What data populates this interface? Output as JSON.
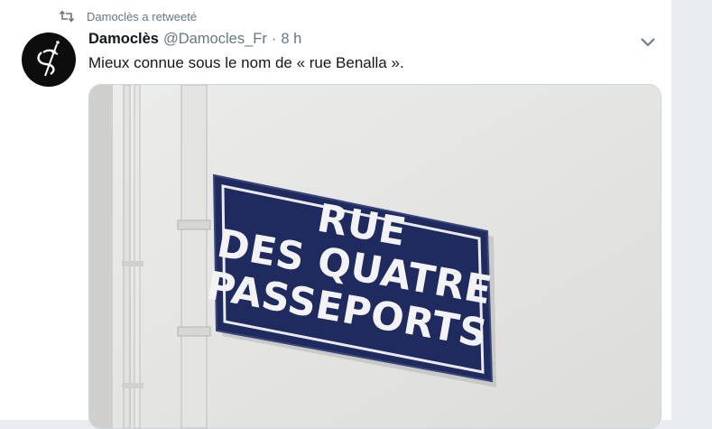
{
  "retweet": {
    "icon": "retweet-icon",
    "text": "Damoclès a retweeté"
  },
  "tweet": {
    "author_name": "Damoclès",
    "handle": "@Damocles_Fr",
    "separator": "·",
    "time": "8 h",
    "text": "Mieux connue sous le nom de « rue Benalla ».",
    "avatar_icon": "dagger-dollar-logo",
    "menu_icon": "chevron-down-icon"
  },
  "media": {
    "sign_lines": [
      "RUE",
      "DES QUATRE",
      "PASSEPORTS"
    ],
    "sign_color": "#1f2a5e"
  }
}
